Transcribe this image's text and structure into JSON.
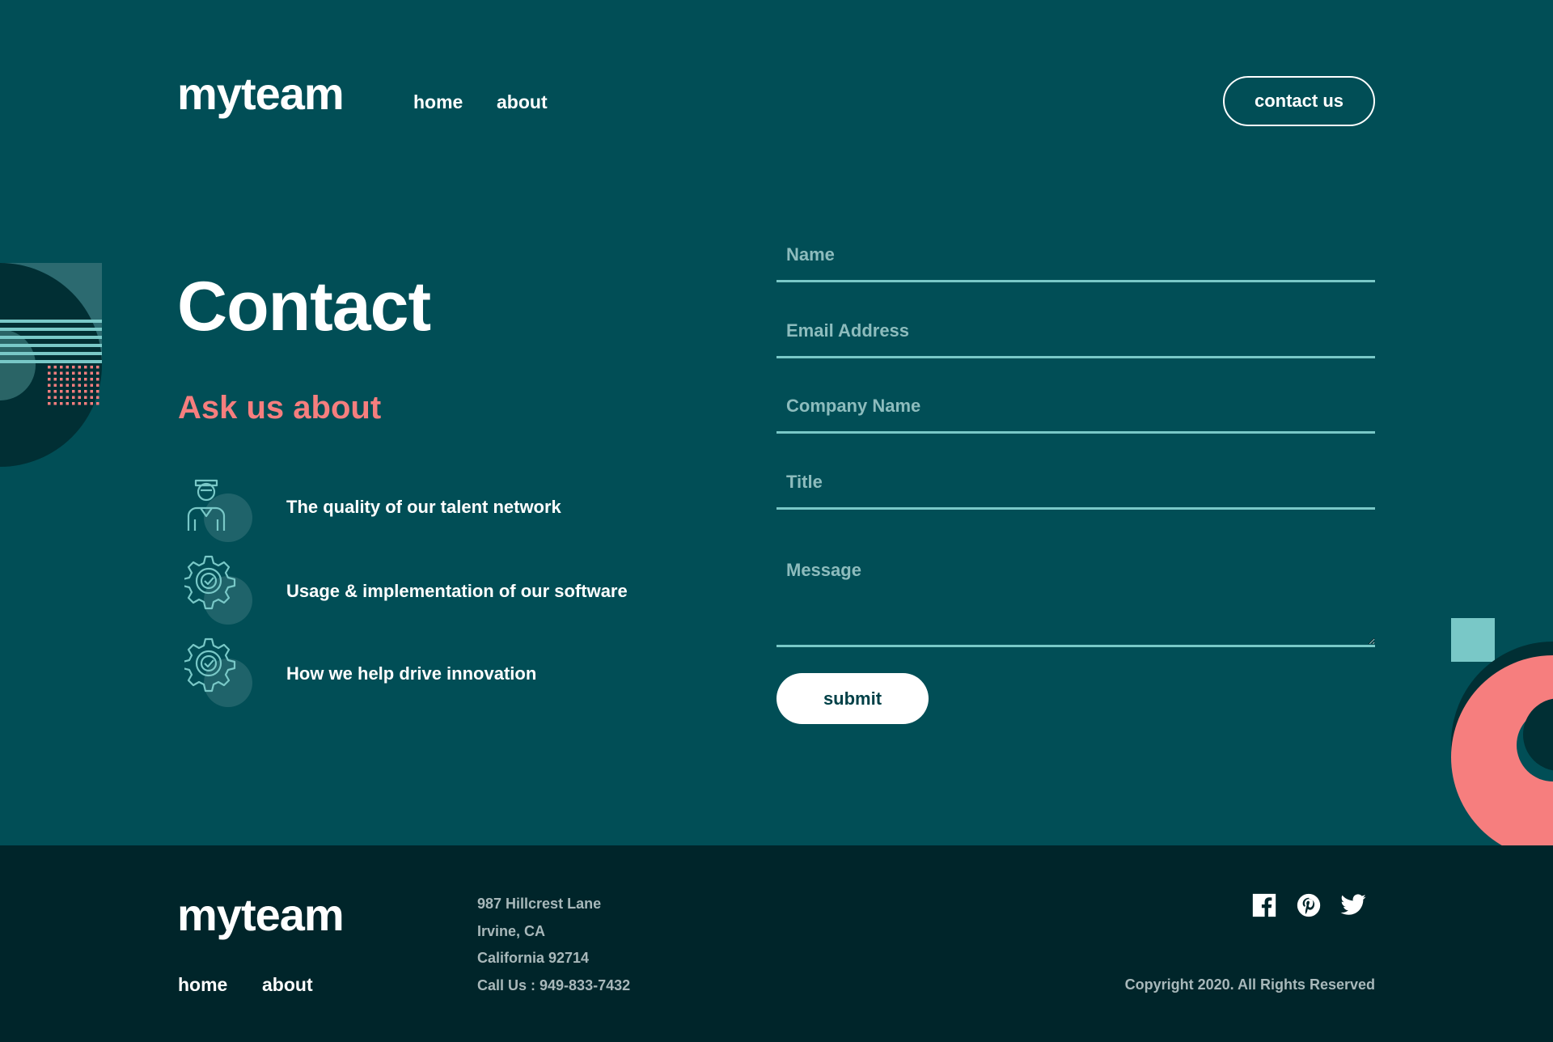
{
  "colors": {
    "background": "#014e56",
    "footer": "#00252a",
    "accent_coral": "#f67e7e",
    "accent_teal": "#79c8c7",
    "dark_circle": "#012f34"
  },
  "header": {
    "logo": "myteam",
    "nav": [
      {
        "label": "home"
      },
      {
        "label": "about"
      }
    ],
    "cta_label": "contact us"
  },
  "main": {
    "title": "Contact",
    "subtitle": "Ask us about",
    "topics": [
      {
        "icon": "person-icon",
        "text": "The quality of our talent network"
      },
      {
        "icon": "gear-check-icon",
        "text": "Usage & implementation of our software"
      },
      {
        "icon": "gear-check-icon",
        "text": "How we help drive innovation"
      }
    ]
  },
  "form": {
    "name_placeholder": "Name",
    "email_placeholder": "Email Address",
    "company_placeholder": "Company Name",
    "title_placeholder": "Title",
    "message_placeholder": "Message",
    "submit_label": "submit"
  },
  "footer": {
    "logo": "myteam",
    "nav": [
      {
        "label": "home"
      },
      {
        "label": "about"
      }
    ],
    "address": [
      "987 Hillcrest Lane",
      "Irvine, CA",
      "California 92714",
      "Call Us : 949-833-7432"
    ],
    "social": [
      "facebook-icon",
      "pinterest-icon",
      "twitter-icon"
    ],
    "copyright": "Copyright 2020. All Rights Reserved"
  }
}
